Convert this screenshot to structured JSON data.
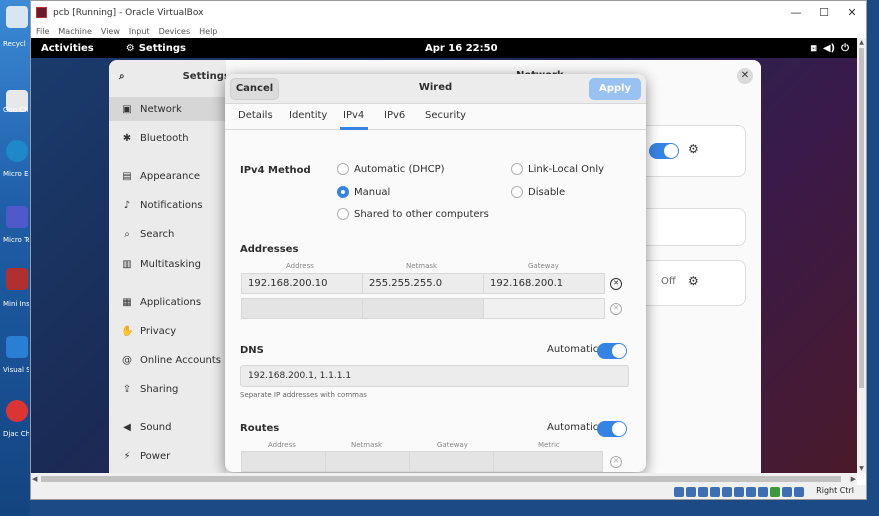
{
  "desktop": {
    "icons": [
      {
        "label": "Recycl",
        "color": "#d9e6f2"
      },
      {
        "label": "Goo Chro",
        "color": "#e8e8e8"
      },
      {
        "label": "Micro Edg",
        "color": "#1e88c8"
      },
      {
        "label": "Micro Tea",
        "color": "#5059c9"
      },
      {
        "label": "Mini Insta",
        "color": "#b03030"
      },
      {
        "label": "Visual S Co",
        "color": "#2a7fd4"
      },
      {
        "label": "Djac Chro",
        "color": "#d33"
      }
    ]
  },
  "vbox": {
    "title": "pcb [Running] - Oracle VirtualBox",
    "menu": [
      "File",
      "Machine",
      "View",
      "Input",
      "Devices",
      "Help"
    ],
    "window_controls": [
      "—",
      "☐",
      "✕"
    ],
    "host_key": "Right Ctrl"
  },
  "gnome_topbar": {
    "activities": "Activities",
    "app_name": "Settings",
    "clock": "Apr 16  22:50"
  },
  "settings": {
    "sidebar_title": "Settings",
    "main_title": "Network",
    "items": [
      {
        "label": "Network",
        "icon": "network-icon",
        "glyph": "▣",
        "active": true
      },
      {
        "label": "Bluetooth",
        "icon": "bluetooth-icon",
        "glyph": "✱",
        "active": false
      },
      {
        "label": "Appearance",
        "icon": "appearance-icon",
        "glyph": "▤",
        "active": false
      },
      {
        "label": "Notifications",
        "icon": "bell-icon",
        "glyph": "♪",
        "active": false
      },
      {
        "label": "Search",
        "icon": "search-icon",
        "glyph": "⌕",
        "active": false
      },
      {
        "label": "Multitasking",
        "icon": "multitasking-icon",
        "glyph": "▥",
        "active": false
      },
      {
        "label": "Applications",
        "icon": "applications-icon",
        "glyph": "▦",
        "active": false
      },
      {
        "label": "Privacy",
        "icon": "privacy-icon",
        "glyph": "✋",
        "active": false
      },
      {
        "label": "Online Accounts",
        "icon": "online-accounts-icon",
        "glyph": "@",
        "active": false
      },
      {
        "label": "Sharing",
        "icon": "sharing-icon",
        "glyph": "⇪",
        "active": false
      },
      {
        "label": "Sound",
        "icon": "sound-icon",
        "glyph": "◀",
        "active": false
      },
      {
        "label": "Power",
        "icon": "power-icon",
        "glyph": "⚡",
        "active": false
      }
    ],
    "off_label": "Off"
  },
  "dialog": {
    "title": "Wired",
    "cancel_label": "Cancel",
    "apply_label": "Apply",
    "tabs": [
      "Details",
      "Identity",
      "IPv4",
      "IPv6",
      "Security"
    ],
    "active_tab": "IPv4",
    "ipv4_method_label": "IPv4 Method",
    "methods": {
      "dhcp": "Automatic (DHCP)",
      "link_local": "Link-Local Only",
      "manual": "Manual",
      "disable": "Disable",
      "shared": "Shared to other computers"
    },
    "selected_method": "Manual",
    "addresses_label": "Addresses",
    "address_columns": [
      "Address",
      "Netmask",
      "Gateway"
    ],
    "addresses": [
      {
        "address": "192.168.200.10",
        "netmask": "255.255.255.0",
        "gateway": "192.168.200.1"
      },
      {
        "address": "",
        "netmask": "",
        "gateway": ""
      }
    ],
    "dns_label": "DNS",
    "dns_auto_label": "Automatic",
    "dns_auto": true,
    "dns_value": "192.168.200.1, 1.1.1.1",
    "dns_hint": "Separate IP addresses with commas",
    "routes_label": "Routes",
    "routes_auto_label": "Automatic",
    "routes_auto": true,
    "route_columns": [
      "Address",
      "Netmask",
      "Gateway",
      "Metric"
    ]
  }
}
